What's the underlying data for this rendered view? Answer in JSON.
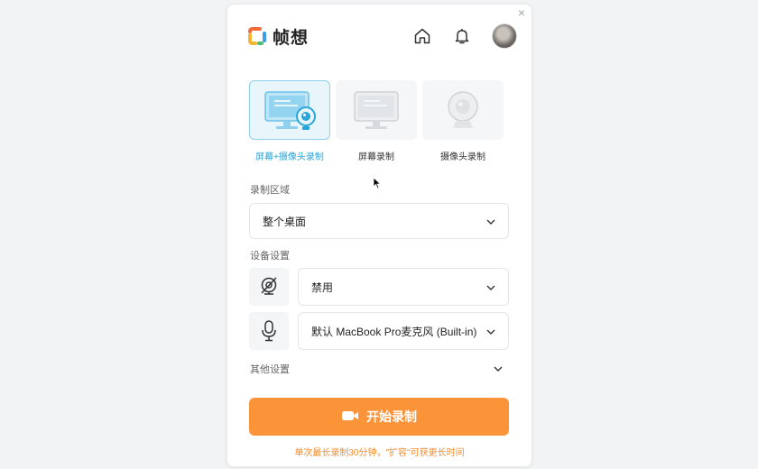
{
  "app": {
    "name": "帧想",
    "close_glyph": "×"
  },
  "header": {
    "icons": [
      "home-icon",
      "bell-icon"
    ],
    "avatar": "avatar"
  },
  "modes": [
    {
      "label": "屏幕+摄像头录制",
      "icon": "screen-camera-icon",
      "active": true
    },
    {
      "label": "屏幕录制",
      "icon": "screen-icon",
      "active": false
    },
    {
      "label": "摄像头录制",
      "icon": "webcam-icon",
      "active": false
    }
  ],
  "record_area": {
    "label": "录制区域",
    "value": "整个桌面"
  },
  "devices": {
    "label": "设备设置",
    "camera": {
      "icon": "camera-disabled-icon",
      "value": "禁用"
    },
    "microphone": {
      "icon": "microphone-icon",
      "value": "默认 MacBook Pro麦克风 (Built-in)"
    }
  },
  "other": {
    "label": "其他设置"
  },
  "start_button": {
    "label": "开始录制",
    "color": "#fb9338"
  },
  "hint": "单次最长录制30分钟，\"扩容\"可获更长时间",
  "colors": {
    "accent_blue": "#2aa5d8",
    "accent_orange": "#fb9338"
  }
}
